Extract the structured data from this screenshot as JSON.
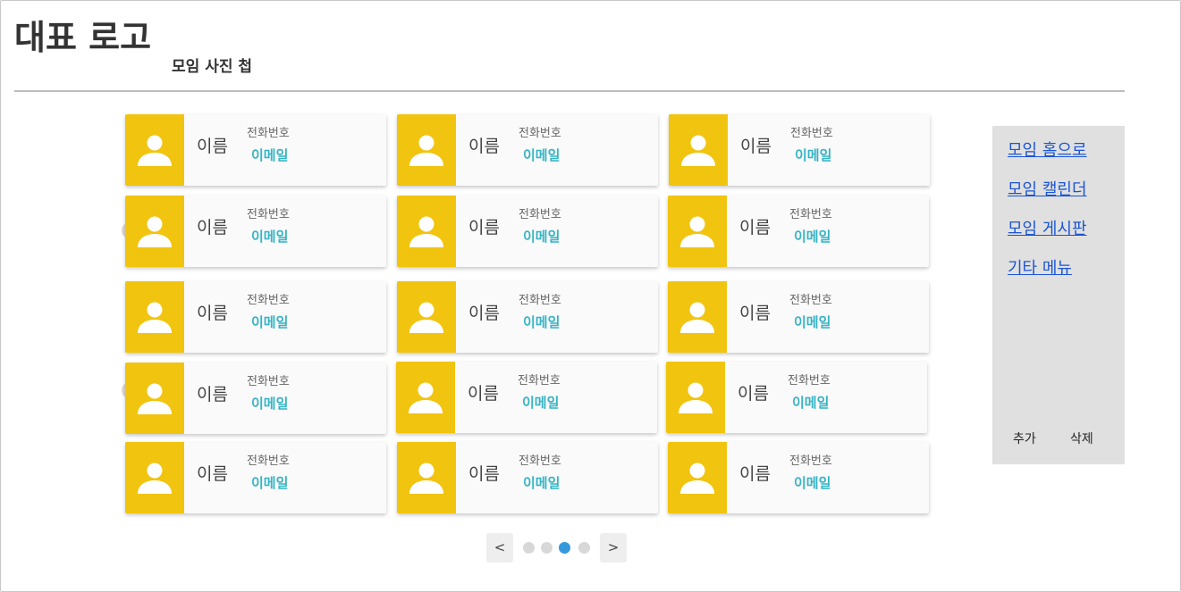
{
  "header": {
    "logo": "대표 로고",
    "subtitle": "모임 사진 첩"
  },
  "cards": [
    {
      "name": "이름",
      "phone": "전화번호",
      "email": "이메일"
    },
    {
      "name": "이름",
      "phone": "전화번호",
      "email": "이메일"
    },
    {
      "name": "이름",
      "phone": "전화번호",
      "email": "이메일"
    },
    {
      "name": "이름",
      "phone": "전화번호",
      "email": "이메일"
    },
    {
      "name": "이름",
      "phone": "전화번호",
      "email": "이메일"
    },
    {
      "name": "이름",
      "phone": "전화번호",
      "email": "이메일"
    },
    {
      "name": "이름",
      "phone": "전화번호",
      "email": "이메일"
    },
    {
      "name": "이름",
      "phone": "전화번호",
      "email": "이메일"
    },
    {
      "name": "이름",
      "phone": "전화번호",
      "email": "이메일"
    },
    {
      "name": "이름",
      "phone": "전화번호",
      "email": "이메일"
    },
    {
      "name": "이름",
      "phone": "전화번호",
      "email": "이메일"
    },
    {
      "name": "이름",
      "phone": "전화번호",
      "email": "이메일"
    },
    {
      "name": "이름",
      "phone": "전화번호",
      "email": "이메일"
    },
    {
      "name": "이름",
      "phone": "전화번호",
      "email": "이메일"
    },
    {
      "name": "이름",
      "phone": "전화번호",
      "email": "이메일"
    }
  ],
  "sidebar": {
    "links": [
      "모임 홈으로",
      "모임 캘린더",
      "모임 게시판",
      "기타 메뉴"
    ],
    "add_label": "추가",
    "delete_label": "삭제"
  },
  "pagination": {
    "prev": "<",
    "next": ">",
    "active_page": 3,
    "page_count": 4
  },
  "colors": {
    "avatar_bg": "#f1c40f",
    "email_text": "#35b4c4",
    "link": "#1a55d6",
    "active_dot": "#3498db"
  },
  "icons": {
    "avatar": "user-icon"
  }
}
